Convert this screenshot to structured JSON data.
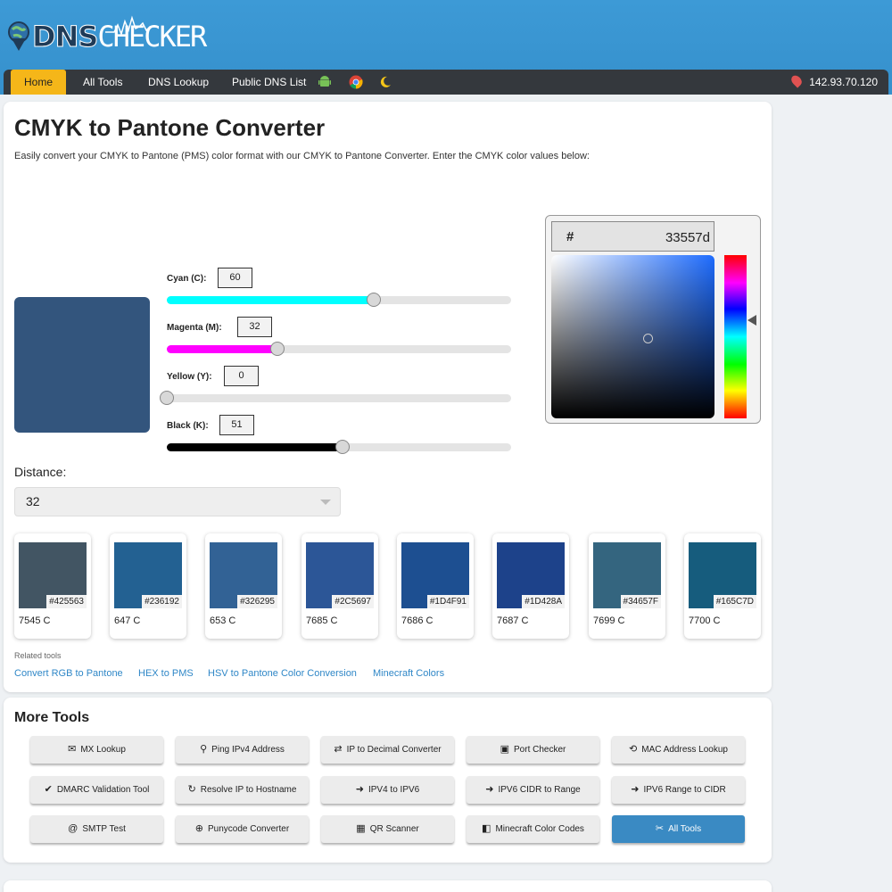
{
  "header": {
    "logo_dns": "DNS",
    "logo_checker": "CHECKER",
    "nav": [
      "Home",
      "All Tools",
      "DNS Lookup",
      "Public DNS List"
    ],
    "nav_icons": [
      "android-icon",
      "chrome-icon",
      "moon-icon"
    ],
    "ip": "142.93.70.120"
  },
  "converter": {
    "title": "CMYK to Pantone Converter",
    "description": "Easily convert your CMYK to Pantone (PMS) color format with our CMYK to Pantone Converter. Enter the CMYK color values below:",
    "preview_color": "#33557d",
    "sliders": [
      {
        "label": "Cyan (C):",
        "value": "60",
        "fill": "#00ffff"
      },
      {
        "label": "Magenta (M):",
        "value": "32",
        "fill": "#ff00ff"
      },
      {
        "label": "Yellow (Y):",
        "value": "0",
        "fill": "#ffff00"
      },
      {
        "label": "Black (K):",
        "value": "51",
        "fill": "#000000"
      }
    ],
    "picker": {
      "hash": "#",
      "hex": "33557d"
    },
    "distance_label": "Distance:",
    "distance_value": "32",
    "results": [
      {
        "hex": "#425563",
        "name": "7545 C"
      },
      {
        "hex": "#236192",
        "name": "647 C"
      },
      {
        "hex": "#326295",
        "name": "653 C"
      },
      {
        "hex": "#2C5697",
        "name": "7685 C"
      },
      {
        "hex": "#1D4F91",
        "name": "7686 C"
      },
      {
        "hex": "#1D428A",
        "name": "7687 C"
      },
      {
        "hex": "#34657F",
        "name": "7699 C"
      },
      {
        "hex": "#165C7D",
        "name": "7700 C"
      }
    ],
    "related_label": "Related tools",
    "related_links": [
      "Convert RGB to Pantone",
      "HEX to PMS",
      "HSV to Pantone Color Conversion",
      "Minecraft Colors"
    ]
  },
  "more_tools": {
    "title": "More Tools",
    "tools": [
      {
        "label": "MX Lookup",
        "icon": "mail-server-icon",
        "glyph": "✉"
      },
      {
        "label": "Ping IPv4 Address",
        "icon": "location-pin-icon",
        "glyph": "⚲"
      },
      {
        "label": "IP to Decimal Converter",
        "icon": "swap-arrows-icon",
        "glyph": "⇄"
      },
      {
        "label": "Port Checker",
        "icon": "ethernet-port-icon",
        "glyph": "▣"
      },
      {
        "label": "MAC Address Lookup",
        "icon": "network-cable-icon",
        "glyph": "⟲"
      },
      {
        "label": "DMARC Validation Tool",
        "icon": "check-circle-icon",
        "glyph": "✔"
      },
      {
        "label": "Resolve IP to Hostname",
        "icon": "refresh-icon",
        "glyph": "↻"
      },
      {
        "label": "IPV4 to IPV6",
        "icon": "arrow-right-icon",
        "glyph": "➜"
      },
      {
        "label": "IPV6 CIDR to Range",
        "icon": "arrow-right-icon",
        "glyph": "➜"
      },
      {
        "label": "IPV6 Range to CIDR",
        "icon": "arrow-right-icon",
        "glyph": "➜"
      },
      {
        "label": "SMTP Test",
        "icon": "at-sign-icon",
        "glyph": "@"
      },
      {
        "label": "Punycode Converter",
        "icon": "globe-icon",
        "glyph": "⊕"
      },
      {
        "label": "QR Scanner",
        "icon": "qr-code-icon",
        "glyph": "▦"
      },
      {
        "label": "Minecraft Color Codes",
        "icon": "minecraft-icon",
        "glyph": "◧"
      },
      {
        "label": "All Tools",
        "icon": "tools-icon",
        "glyph": "✂"
      }
    ]
  }
}
